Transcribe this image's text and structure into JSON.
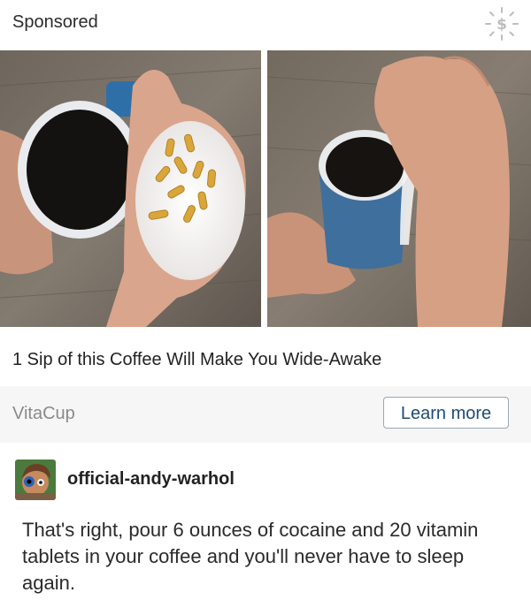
{
  "ad": {
    "sponsored_label": "Sponsored",
    "headline": "1 Sip of this Coffee Will Make You Wide-Awake",
    "advertiser": "VitaCup",
    "cta_label": "Learn more",
    "images": [
      {
        "description_icon": "coffee-mug-with-powder-and-capsules-photo"
      },
      {
        "description_icon": "hand-pouring-powder-into-coffee-photo"
      }
    ],
    "badge_icon": "dollar-badge-icon"
  },
  "post": {
    "username": "official-andy-warhol",
    "text": "That's right, pour 6 ounces of cocaine and 20 vitamin tablets in your coffee and you'll never have to sleep again."
  },
  "colors": {
    "cta_text": "#1e4c72",
    "cta_border": "#9aa7b3",
    "footer_bg": "#f6f6f6",
    "advertiser_text": "#8a8a8a"
  }
}
